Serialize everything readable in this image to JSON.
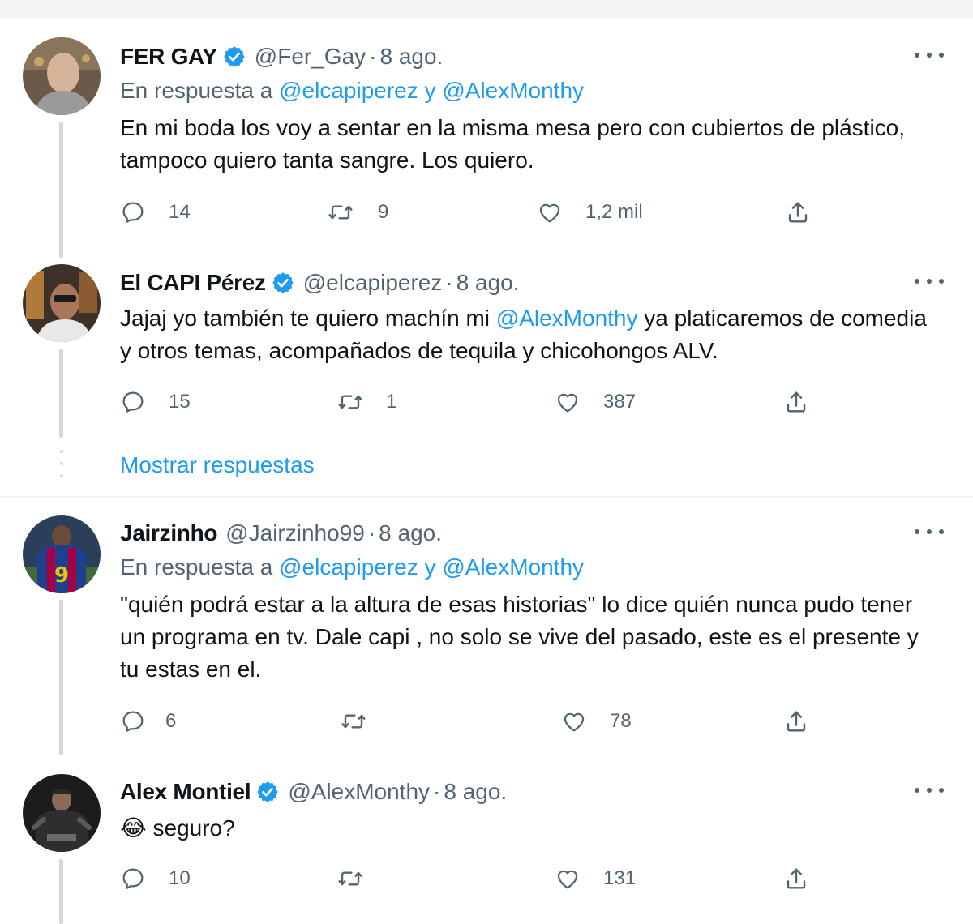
{
  "tweets": [
    {
      "name": "FER GAY",
      "verified": true,
      "handle": "@Fer_Gay",
      "dot": "·",
      "time": "8 ago.",
      "reply_prefix": "En respuesta a ",
      "reply_mention_1": "@elcapiperez",
      "reply_joiner": " y ",
      "reply_mention_2": "@AlexMonthy",
      "text": "En mi boda los voy a sentar en la misma mesa pero con cubiertos de plástico, tampoco quiero tanta sangre. Los quiero.",
      "replies": "14",
      "retweets": "9",
      "likes": "1,2 mil"
    },
    {
      "name": "El CAPI Pérez",
      "verified": true,
      "handle": "@elcapiperez",
      "dot": "·",
      "time": "8 ago.",
      "text_before": "Jajaj yo también te quiero machín mi ",
      "text_mention": "@AlexMonthy",
      "text_after": " ya platicaremos de comedia y otros temas, acompañados de tequila y chicohongos ALV.",
      "replies": "15",
      "retweets": "1",
      "likes": "387"
    },
    {
      "name": "Jairzinho",
      "verified": false,
      "handle": "@Jairzinho99",
      "dot": "·",
      "time": "8 ago.",
      "reply_prefix": "En respuesta a ",
      "reply_mention_1": "@elcapiperez",
      "reply_joiner": " y ",
      "reply_mention_2": "@AlexMonthy",
      "text": "\"quién podrá estar a la altura de esas historias\"  lo dice quién nunca pudo tener un programa en tv. Dale capi , no solo se vive del pasado, este es el presente y tu estas en el.",
      "replies": "6",
      "retweets": "",
      "likes": "78"
    },
    {
      "name": "Alex Montiel",
      "verified": true,
      "handle": "@AlexMonthy",
      "dot": "·",
      "time": "8 ago.",
      "emoji": "😂",
      "text": " seguro?",
      "replies": "10",
      "retweets": "",
      "likes": "131"
    }
  ],
  "show_replies": "Mostrar respuestas",
  "icons": {
    "reply": "reply-icon",
    "retweet": "retweet-icon",
    "like": "heart-icon",
    "share": "share-icon",
    "more": "more-icon",
    "verified": "verified-badge-icon"
  },
  "colors": {
    "link": "#1d9bf0",
    "secondary_text": "#536471",
    "primary_text": "#0f1419",
    "verified": "#1d9bf0",
    "thread_line": "#cfd9de"
  }
}
